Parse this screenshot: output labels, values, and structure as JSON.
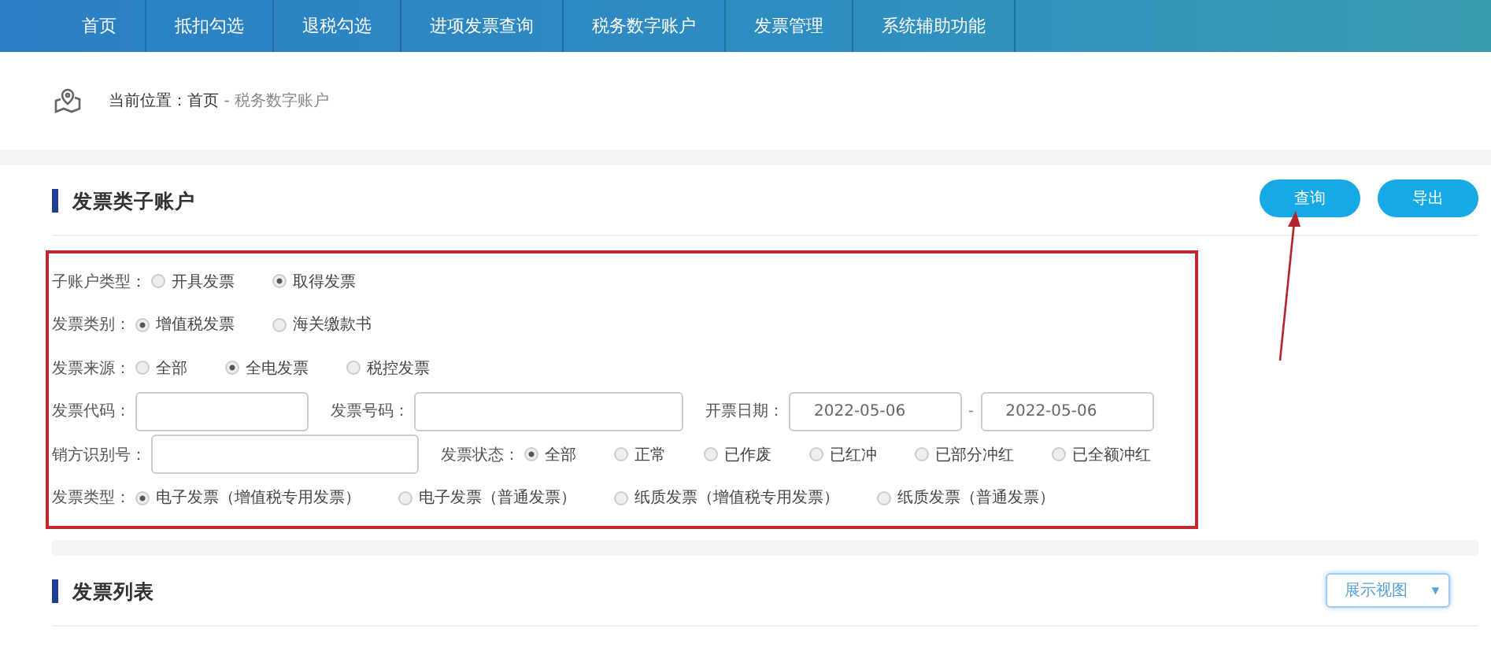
{
  "nav": [
    "首页",
    "抵扣勾选",
    "退税勾选",
    "进项发票查询",
    "税务数字账户",
    "发票管理",
    "系统辅助功能"
  ],
  "breadcrumb": {
    "prefix": "当前位置：",
    "home": "首页",
    "separator": "-",
    "current": "税务数字账户"
  },
  "section1": {
    "title": "发票类子账户",
    "buttons": [
      "查询",
      "导出"
    ]
  },
  "filters": [
    [
      {
        "kind": "radio",
        "label": "子账户类型：",
        "options": [
          {
            "label": "开具发票",
            "selected": false
          },
          {
            "label": "取得发票",
            "selected": true
          }
        ]
      }
    ],
    [
      {
        "kind": "radio",
        "label": "发票类别：",
        "options": [
          {
            "label": "增值税发票",
            "selected": true
          },
          {
            "label": "海关缴款书",
            "selected": false
          }
        ]
      }
    ],
    [
      {
        "kind": "radio",
        "label": "发票来源：",
        "options": [
          {
            "label": "全部",
            "selected": false
          },
          {
            "label": "全电发票",
            "selected": true
          },
          {
            "label": "税控发票",
            "selected": false
          }
        ]
      }
    ],
    [
      {
        "kind": "input",
        "label": "发票代码："
      },
      {
        "kind": "input",
        "label": "发票号码："
      },
      {
        "kind": "date_range",
        "label": "开票日期：",
        "from": "2022-05-06",
        "separator": "-",
        "to": "2022-05-06"
      }
    ],
    [
      {
        "kind": "input",
        "label": "销方识别号："
      },
      {
        "kind": "radio",
        "label": "发票状态：",
        "options": [
          {
            "label": "全部",
            "selected": true
          },
          {
            "label": "正常",
            "selected": false
          },
          {
            "label": "已作废",
            "selected": false
          },
          {
            "label": "已红冲",
            "selected": false
          },
          {
            "label": "已部分冲红",
            "selected": false
          },
          {
            "label": "已全额冲红",
            "selected": false
          }
        ]
      }
    ],
    [
      {
        "kind": "radio",
        "label": "发票类型：",
        "options": [
          {
            "label": "电子发票（增值税专用发票）",
            "selected": true
          },
          {
            "label": "电子发票（普通发票）",
            "selected": false
          },
          {
            "label": "纸质发票（增值税专用发票）",
            "selected": false
          },
          {
            "label": "纸质发票（普通发票）",
            "selected": false
          }
        ]
      }
    ]
  ],
  "section2": {
    "title": "发票列表",
    "view_select": {
      "value": "展示视图",
      "caret": "▼"
    }
  }
}
